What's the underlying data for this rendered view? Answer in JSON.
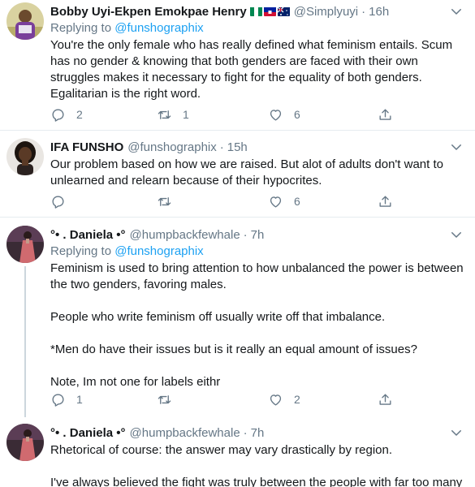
{
  "tweets": [
    {
      "name": "Bobby Uyi-Ekpen Emokpae Henry",
      "handle": "@Simplyuyi",
      "time": "16h",
      "replying_prefix": "Replying to ",
      "replying_to": "@funshographix",
      "text": "You're the only female who has really defined what feminism entails. Scum has no gender & knowing that both genders are faced with their own struggles makes it necessary to fight for the equality of both genders. Egalitarian is the right word.",
      "replies": "2",
      "retweets": "1",
      "likes": "6"
    },
    {
      "name": "IFA FUNSHO",
      "handle": "@funshographix",
      "time": "15h",
      "text": "Our problem based on how we are raised. But alot of adults don't want to unlearned and relearn because of their hypocrites.",
      "replies": "",
      "retweets": "",
      "likes": "6"
    },
    {
      "name": "°• . Daniela •°",
      "handle": "@humpbackfewhale",
      "time": "7h",
      "replying_prefix": "Replying to ",
      "replying_to": "@funshographix",
      "text": "Feminism is used to bring attention to how unbalanced the power is between the two genders, favoring males.\n\nPeople who write feminism off usually write off that imbalance.\n\n*Men do have their issues but is it really an equal amount of issues?\n\nNote, Im not one for labels eithr",
      "replies": "1",
      "retweets": "",
      "likes": "2"
    },
    {
      "name": "°• . Daniela •°",
      "handle": "@humpbackfewhale",
      "time": "7h",
      "text": "Rhetorical of course: the answer may vary drastically by region.\n\nI've always believed the fight was truly between the people with far too many"
    }
  ],
  "colors": {
    "link": "#1da1f2",
    "muted": "#657786",
    "divider": "#e6ecf0"
  },
  "flags": [
    "nigeria-flag",
    "haiti-flag",
    "australia-flag"
  ]
}
